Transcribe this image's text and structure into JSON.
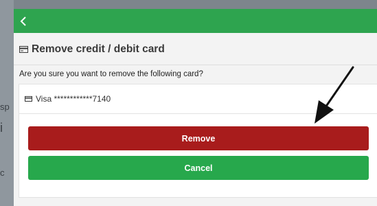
{
  "background": {
    "fragments": [
      "sp",
      "i",
      "c"
    ]
  },
  "header": {
    "back_icon": "chevron-left-icon",
    "color": "#2ea44f"
  },
  "dialog": {
    "title": "Remove credit / debit card",
    "title_icon": "credit-card-icon",
    "question": "Are you sure you want to remove the following card?",
    "card": {
      "icon": "credit-card-icon",
      "label": "Visa ************7140"
    },
    "remove_label": "Remove",
    "cancel_label": "Cancel",
    "remove_color": "#a81c1c",
    "cancel_color": "#27a84c"
  }
}
